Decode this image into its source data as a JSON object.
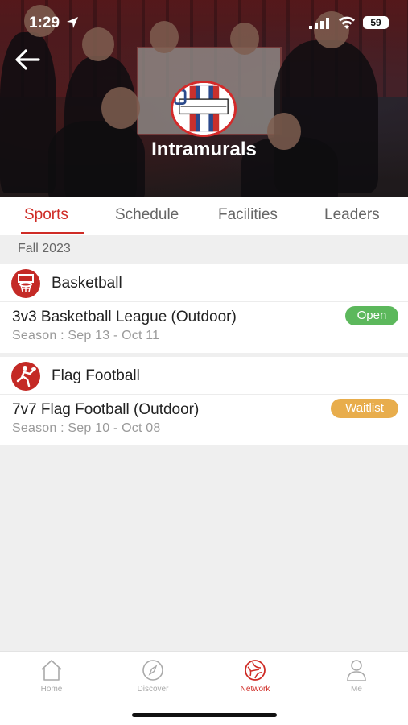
{
  "status": {
    "time": "1:29",
    "battery": "59"
  },
  "hero": {
    "title": "Intramurals"
  },
  "tabs": [
    {
      "label": "Sports",
      "active": true
    },
    {
      "label": "Schedule",
      "active": false
    },
    {
      "label": "Facilities",
      "active": false
    },
    {
      "label": "Leaders",
      "active": false
    }
  ],
  "season": "Fall 2023",
  "sports": [
    {
      "name": "Basketball",
      "icon": "basketball-hoop-icon",
      "league": "3v3 Basketball League (Outdoor)",
      "dates": "Season : Sep 13 - Oct 11",
      "status": "Open",
      "status_color": "#5cb85c"
    },
    {
      "name": "Flag Football",
      "icon": "football-player-icon",
      "league": "7v7 Flag Football (Outdoor)",
      "dates": "Season : Sep 10 - Oct 08",
      "status": "Waitlist",
      "status_color": "#e8ad4c"
    }
  ],
  "nav": [
    {
      "label": "Home",
      "icon": "home-icon",
      "active": false
    },
    {
      "label": "Discover",
      "icon": "compass-icon",
      "active": false
    },
    {
      "label": "Network",
      "icon": "network-icon",
      "active": true
    },
    {
      "label": "Me",
      "icon": "person-icon",
      "active": false
    }
  ],
  "colors": {
    "accent": "#cf2c26",
    "open": "#5cb85c",
    "waitlist": "#e8ad4c"
  }
}
